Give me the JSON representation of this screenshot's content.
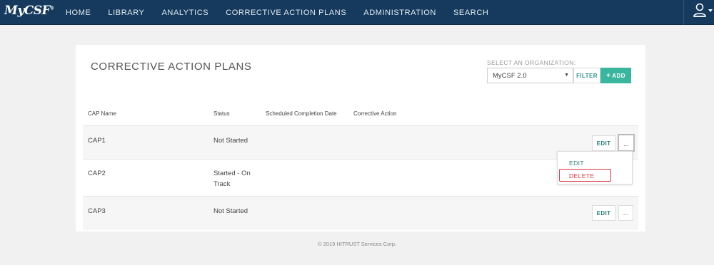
{
  "app": {
    "logo_text": "MyCSF",
    "logo_mark": "®"
  },
  "nav": {
    "items": [
      {
        "label": "HOME"
      },
      {
        "label": "LIBRARY"
      },
      {
        "label": "ANALYTICS"
      },
      {
        "label": "CORRECTIVE ACTION PLANS"
      },
      {
        "label": "ADMINISTRATION"
      },
      {
        "label": "SEARCH"
      }
    ],
    "user_icon": "user-icon"
  },
  "page": {
    "title": "CORRECTIVE ACTION PLANS"
  },
  "org": {
    "label": "SELECT AN ORGANIZATION:",
    "selected": "MyCSF 2.0",
    "caret": "▼"
  },
  "toolbar": {
    "filter_label": "FILTER",
    "add_label": "ADD",
    "add_icon": "+"
  },
  "table": {
    "headers": [
      "CAP Name",
      "Status",
      "Scheduled Completion Date",
      "Corrective Action"
    ],
    "rows": [
      {
        "name": "CAP1",
        "status": "Not Started",
        "date": "",
        "action": ""
      },
      {
        "name": "CAP2",
        "status": "Started - On Track",
        "date": "",
        "action": ""
      },
      {
        "name": "CAP3",
        "status": "Not Started",
        "date": "",
        "action": ""
      }
    ],
    "edit_label": "EDIT",
    "more_label": "..."
  },
  "row_menu": {
    "edit_label": "EDIT",
    "delete_label": "DELETE"
  },
  "footer": {
    "text": "© 2019 HITRUST Services Corp."
  },
  "colors": {
    "nav_bg": "#153a5e",
    "accent": "#3ab59e",
    "link": "#2c7f7b",
    "danger": "#d9363e"
  }
}
